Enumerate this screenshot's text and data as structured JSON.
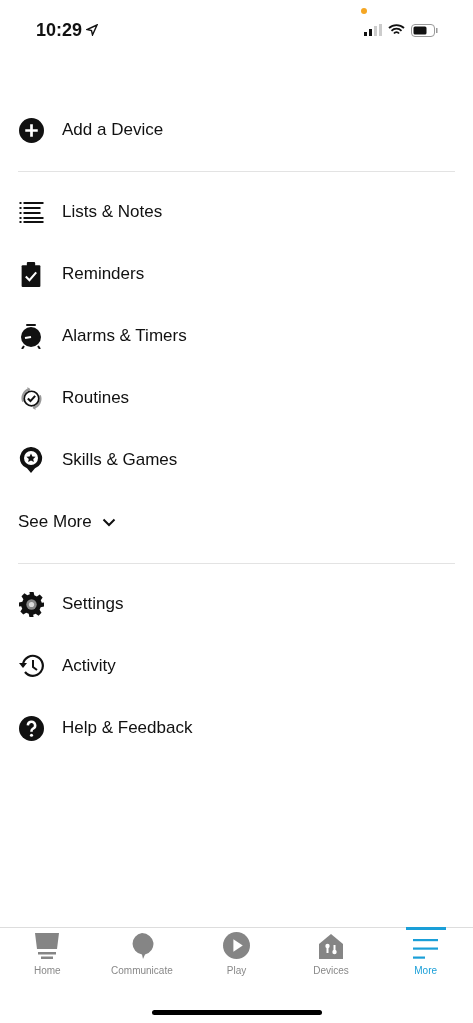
{
  "status_bar": {
    "time": "10:29"
  },
  "menu": {
    "sections": [
      {
        "items": [
          {
            "label": "Add a Device"
          }
        ]
      },
      {
        "items": [
          {
            "label": "Lists & Notes"
          },
          {
            "label": "Reminders"
          },
          {
            "label": "Alarms & Timers"
          },
          {
            "label": "Routines"
          },
          {
            "label": "Skills & Games"
          }
        ],
        "see_more": {
          "label": "See More",
          "expanded": false
        }
      },
      {
        "items": [
          {
            "label": "Settings"
          },
          {
            "label": "Activity"
          },
          {
            "label": "Help & Feedback"
          }
        ]
      }
    ]
  },
  "tab_bar": [
    {
      "label": "Home",
      "selected": false
    },
    {
      "label": "Communicate",
      "selected": false
    },
    {
      "label": "Play",
      "selected": false
    },
    {
      "label": "Devices",
      "selected": false
    },
    {
      "label": "More",
      "selected": true
    }
  ]
}
